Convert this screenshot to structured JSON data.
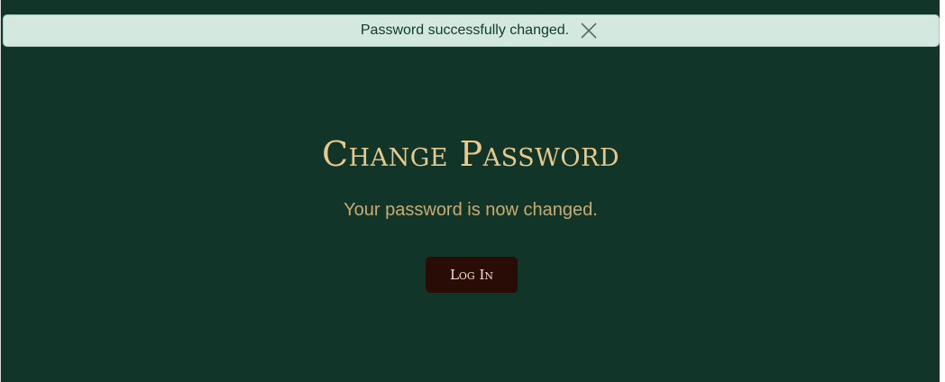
{
  "notice": {
    "message": "Password successfully changed.",
    "close_icon": "close-icon",
    "background_color": "#d3e8de",
    "text_color": "#123a2d"
  },
  "main": {
    "title": "Change Password",
    "message": "Your password is now changed.",
    "login_button_label": "Log In",
    "background_color": "#12352a",
    "title_color": "#e7c98a",
    "button_color": "#2a0c07"
  }
}
